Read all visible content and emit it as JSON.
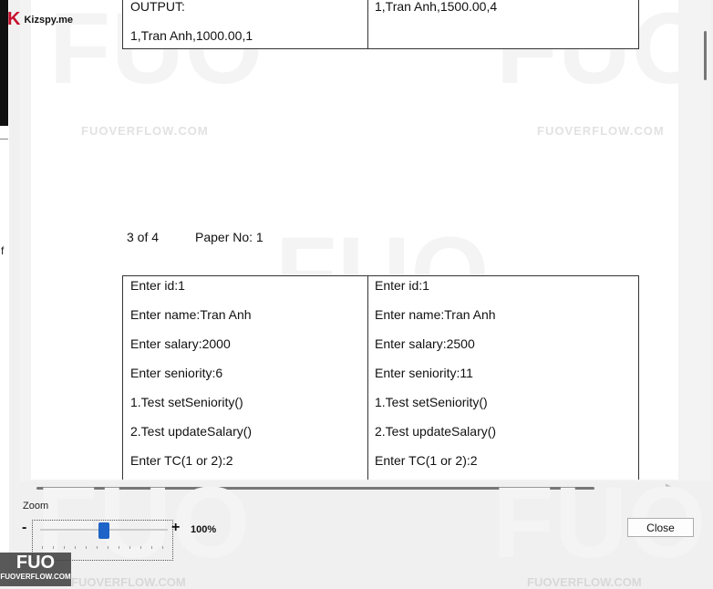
{
  "overlay": {
    "kizspy": "Kizspy.me",
    "kizspy_mark": "K",
    "fuo_badge_main": "FUO",
    "fuo_badge_sub": "FUOVERFLOW.COM",
    "watermark_text": "FUOVERFLOW.COM",
    "watermark_big": "FUO",
    "bottom_watermark": "FUOVERFLOW.COM"
  },
  "left_fragment": "f",
  "document": {
    "top_table": {
      "left": [
        "OUTPUT:",
        "1,Tran Anh,1000.00,1"
      ],
      "right": [
        "1,Tran Anh,1500.00,4"
      ]
    },
    "page_indicator": "3 of 4",
    "paper_no": "Paper No: 1",
    "bottom_table": {
      "left": [
        "Enter id:1",
        "Enter name:Tran Anh",
        "Enter salary:2000",
        "Enter seniority:6",
        "1.Test setSeniority()",
        "2.Test updateSalary()",
        "Enter TC(1 or 2):2"
      ],
      "right": [
        "Enter id:1",
        "Enter name:Tran Anh",
        "Enter salary:2500",
        "Enter seniority:11",
        "1.Test setSeniority()",
        "2.Test updateSalary()",
        "Enter TC(1 or 2):2"
      ]
    }
  },
  "zoom": {
    "label": "Zoom",
    "minus": "-",
    "plus": "+",
    "value": "100%",
    "slider_level": 0.5
  },
  "close_label": "Close",
  "colors": {
    "slider_thumb": "#1e63c7",
    "kizspy_mark": "#c8102e"
  }
}
